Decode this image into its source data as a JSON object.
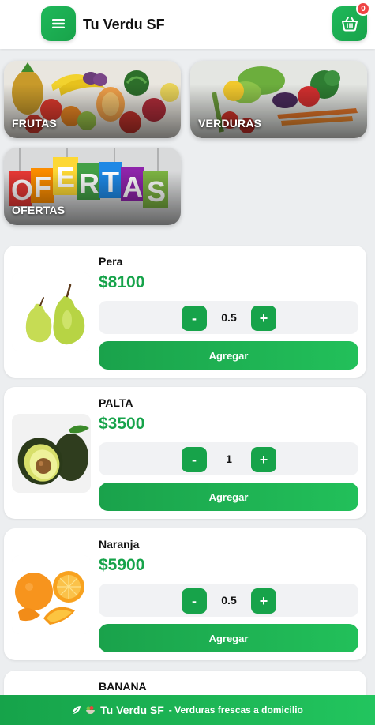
{
  "header": {
    "brand": "Tu Verdu SF",
    "cart_count": "0"
  },
  "categories": [
    {
      "label": "FRUTAS"
    },
    {
      "label": "VERDURAS"
    },
    {
      "label": "OFERTAS",
      "sign_letters": "OFERTAS"
    }
  ],
  "products": [
    {
      "name": "Pera",
      "price": "$8100",
      "qty": "0.5",
      "minus": "-",
      "plus": "+",
      "add_label": "Agregar"
    },
    {
      "name": "PALTA",
      "price": "$3500",
      "qty": "1",
      "minus": "-",
      "plus": "+",
      "add_label": "Agregar"
    },
    {
      "name": "Naranja",
      "price": "$5900",
      "qty": "0.5",
      "minus": "-",
      "plus": "+",
      "add_label": "Agregar"
    },
    {
      "name": "BANANA"
    }
  ],
  "footer": {
    "brand": "Tu Verdu SF",
    "tagline": "- Verduras frescas a domicilio"
  },
  "colors": {
    "accent": "#1fb85a",
    "price": "#16a34a",
    "badge": "#ef4444"
  },
  "icons": [
    "menu-icon",
    "cart-icon",
    "leaf-icon",
    "salad-bowl-icon"
  ]
}
